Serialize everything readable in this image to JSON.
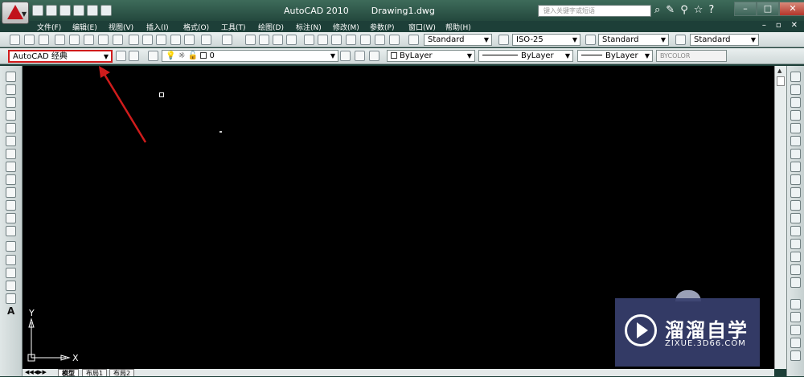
{
  "title": {
    "app": "AutoCAD 2010",
    "document": "Drawing1.dwg"
  },
  "search": {
    "placeholder": "键入关键字或短语"
  },
  "menus": [
    "文件(F)",
    "编辑(E)",
    "视图(V)",
    "插入(I)",
    "格式(O)",
    "工具(T)",
    "绘图(D)",
    "标注(N)",
    "修改(M)",
    "参数(P)",
    "窗口(W)",
    "帮助(H)"
  ],
  "toolbar1": {
    "text_style": "Standard",
    "dim_style": "ISO-25",
    "table_style": "Standard",
    "mleader_style": "Standard"
  },
  "toolbar2": {
    "workspace": "AutoCAD 经典",
    "layer": "0",
    "color": "ByLayer",
    "linetype": "ByLayer",
    "lineweight": "ByLayer",
    "plotstyle": "BYCOLOR"
  },
  "tabs": [
    "模型",
    "布局1",
    "布局2"
  ],
  "ucs": {
    "x": "X",
    "y": "Y"
  },
  "watermark": {
    "brand": "溜溜自学",
    "url": "ZIXUE.3D66.COM"
  },
  "colors": {
    "annotation_arrow": "#d01c1c",
    "canvas": "#000000",
    "titlebar": "#2e584b"
  }
}
